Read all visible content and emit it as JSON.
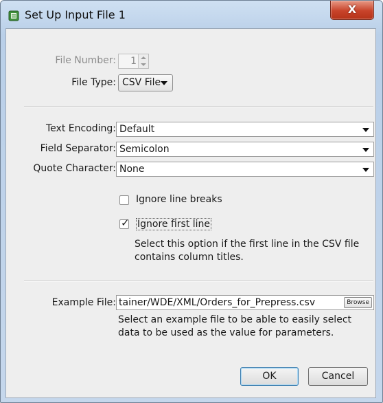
{
  "window": {
    "title": "Set Up Input File 1",
    "close_label": "X"
  },
  "file_number": {
    "label": "File Number:",
    "value": "1"
  },
  "file_type": {
    "label": "File Type:",
    "value": "CSV File"
  },
  "text_encoding": {
    "label": "Text Encoding:",
    "value": "Default"
  },
  "field_separator": {
    "label": "Field Separator:",
    "value": "Semicolon"
  },
  "quote_character": {
    "label": "Quote Character:",
    "value": "None"
  },
  "ignore_line_breaks": {
    "label": "Ignore line breaks",
    "checked": false
  },
  "ignore_first_line": {
    "label": "Ignore first line",
    "checked": true,
    "help_line1": "Select this option if the first line in the CSV file",
    "help_line2": "contains column titles."
  },
  "example_file": {
    "label": "Example File:",
    "value": "tainer/WDE/XML/Orders_for_Prepress.csv",
    "browse_label": "Browse",
    "help_line1": "Select an example file to be able to easily select",
    "help_line2": "data to be used as the value for parameters."
  },
  "buttons": {
    "ok": "OK",
    "cancel": "Cancel"
  }
}
